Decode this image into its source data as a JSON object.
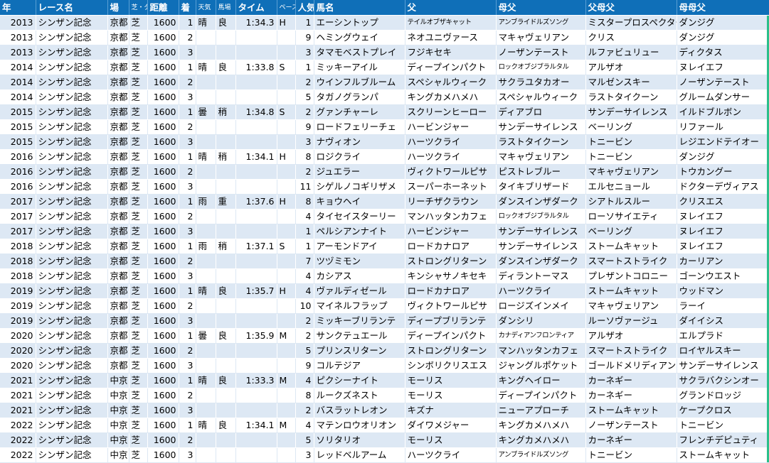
{
  "columns": [
    "年",
    "レース名",
    "場",
    "芝・ダ",
    "距離",
    "着",
    "天気",
    "馬場",
    "タイム",
    "ペース",
    "人気",
    "馬名",
    "父",
    "母父",
    "父母父",
    "母母父"
  ],
  "rows": [
    [
      "2013",
      "シンザン記念",
      "京都",
      "芝",
      "1600",
      "1",
      "晴",
      "良",
      "1:34.3",
      "H",
      "1",
      "エーシントップ",
      "テイルオブザキャット",
      "アンブライドルズソング",
      "ミスタープロスペクター",
      "ダンジグ"
    ],
    [
      "2013",
      "シンザン記念",
      "京都",
      "芝",
      "1600",
      "2",
      "",
      "",
      "",
      "",
      "9",
      "ヘミングウェイ",
      "ネオユニヴァース",
      "マキャヴェリアン",
      "クリス",
      "ダンジグ"
    ],
    [
      "2013",
      "シンザン記念",
      "京都",
      "芝",
      "1600",
      "3",
      "",
      "",
      "",
      "",
      "3",
      "タマモベストプレイ",
      "フジキセキ",
      "ノーザンテースト",
      "ルファビュリュー",
      "ディクタス"
    ],
    [
      "2014",
      "シンザン記念",
      "京都",
      "芝",
      "1600",
      "1",
      "晴",
      "良",
      "1:33.8",
      "S",
      "1",
      "ミッキーアイル",
      "ディープインパクト",
      "ロックオブジブラルタル",
      "アルザオ",
      "ヌレイエフ"
    ],
    [
      "2014",
      "シンザン記念",
      "京都",
      "芝",
      "1600",
      "2",
      "",
      "",
      "",
      "",
      "2",
      "ウインフルブルーム",
      "スペシャルウィーク",
      "サクラユタカオー",
      "マルゼンスキー",
      "ノーザンテースト"
    ],
    [
      "2014",
      "シンザン記念",
      "京都",
      "芝",
      "1600",
      "3",
      "",
      "",
      "",
      "",
      "5",
      "タガノグランパ",
      "キングカメハメハ",
      "スペシャルウィーク",
      "ラストタイクーン",
      "グルームダンサー"
    ],
    [
      "2015",
      "シンザン記念",
      "京都",
      "芝",
      "1600",
      "1",
      "曇",
      "稍",
      "1:34.8",
      "S",
      "2",
      "グァンチャーレ",
      "スクリーンヒーロー",
      "ディアブロ",
      "サンデーサイレンス",
      "イルドブルボン"
    ],
    [
      "2015",
      "シンザン記念",
      "京都",
      "芝",
      "1600",
      "2",
      "",
      "",
      "",
      "",
      "9",
      "ロードフェリーチェ",
      "ハービンジャー",
      "サンデーサイレンス",
      "ベーリング",
      "リファール"
    ],
    [
      "2015",
      "シンザン記念",
      "京都",
      "芝",
      "1600",
      "3",
      "",
      "",
      "",
      "",
      "3",
      "ナヴィオン",
      "ハーツクライ",
      "ラストタイクーン",
      "トニービン",
      "レジエンドテイオー"
    ],
    [
      "2016",
      "シンザン記念",
      "京都",
      "芝",
      "1600",
      "1",
      "晴",
      "稍",
      "1:34.1",
      "H",
      "8",
      "ロジクライ",
      "ハーツクライ",
      "マキャヴェリアン",
      "トニービン",
      "ダンジグ"
    ],
    [
      "2016",
      "シンザン記念",
      "京都",
      "芝",
      "1600",
      "2",
      "",
      "",
      "",
      "",
      "2",
      "ジュエラー",
      "ヴィクトワールピサ",
      "ピストレブルー",
      "マキャヴェリアン",
      "トウカングー"
    ],
    [
      "2016",
      "シンザン記念",
      "京都",
      "芝",
      "1600",
      "3",
      "",
      "",
      "",
      "",
      "11",
      "シゲルノコギリザメ",
      "スーパーホーネット",
      "タイキブリザード",
      "エルセニョール",
      "ドクターデヴィアス"
    ],
    [
      "2017",
      "シンザン記念",
      "京都",
      "芝",
      "1600",
      "1",
      "雨",
      "重",
      "1:37.6",
      "H",
      "8",
      "キョウヘイ",
      "リーチザクラウン",
      "ダンスインザダーク",
      "シアトルスルー",
      "クリスエス"
    ],
    [
      "2017",
      "シンザン記念",
      "京都",
      "芝",
      "1600",
      "2",
      "",
      "",
      "",
      "",
      "4",
      "タイセイスターリー",
      "マンハッタンカフェ",
      "ロックオブジブラルタル",
      "ローソサイエティ",
      "ヌレイエフ"
    ],
    [
      "2017",
      "シンザン記念",
      "京都",
      "芝",
      "1600",
      "3",
      "",
      "",
      "",
      "",
      "1",
      "ペルシアンナイト",
      "ハービンジャー",
      "サンデーサイレンス",
      "ベーリング",
      "ヌレイエフ"
    ],
    [
      "2018",
      "シンザン記念",
      "京都",
      "芝",
      "1600",
      "1",
      "雨",
      "稍",
      "1:37.1",
      "S",
      "1",
      "アーモンドアイ",
      "ロードカナロア",
      "サンデーサイレンス",
      "ストームキャット",
      "ヌレイエフ"
    ],
    [
      "2018",
      "シンザン記念",
      "京都",
      "芝",
      "1600",
      "2",
      "",
      "",
      "",
      "",
      "7",
      "ツヅミモン",
      "ストロングリターン",
      "ダンスインザダーク",
      "スマートストライク",
      "カーリアン"
    ],
    [
      "2018",
      "シンザン記念",
      "京都",
      "芝",
      "1600",
      "3",
      "",
      "",
      "",
      "",
      "4",
      "カシアス",
      "キンシャサノキセキ",
      "ディラントーマス",
      "プレザントコロニー",
      "ゴーンウエスト"
    ],
    [
      "2019",
      "シンザン記念",
      "京都",
      "芝",
      "1600",
      "1",
      "晴",
      "良",
      "1:35.7",
      "H",
      "4",
      "ヴァルディゼール",
      "ロードカナロア",
      "ハーツクライ",
      "ストームキャット",
      "ウッドマン"
    ],
    [
      "2019",
      "シンザン記念",
      "京都",
      "芝",
      "1600",
      "2",
      "",
      "",
      "",
      "",
      "10",
      "マイネルフラップ",
      "ヴィクトワールピサ",
      "ロージズインメイ",
      "マキャヴェリアン",
      "ラーイ"
    ],
    [
      "2019",
      "シンザン記念",
      "京都",
      "芝",
      "1600",
      "3",
      "",
      "",
      "",
      "",
      "2",
      "ミッキーブリランテ",
      "ディープブリランテ",
      "ダンシリ",
      "ルーソヴァージュ",
      "ダイイシス"
    ],
    [
      "2020",
      "シンザン記念",
      "京都",
      "芝",
      "1600",
      "1",
      "曇",
      "良",
      "1:35.9",
      "M",
      "2",
      "サンクテュエール",
      "ディープインパクト",
      "カナディアンフロンティア",
      "アルザオ",
      "エルプラド"
    ],
    [
      "2020",
      "シンザン記念",
      "京都",
      "芝",
      "1600",
      "2",
      "",
      "",
      "",
      "",
      "5",
      "プリンスリターン",
      "ストロングリターン",
      "マンハッタンカフェ",
      "スマートストライク",
      "ロイヤルスキー"
    ],
    [
      "2020",
      "シンザン記念",
      "京都",
      "芝",
      "1600",
      "3",
      "",
      "",
      "",
      "",
      "9",
      "コルテジア",
      "シンボリクリスエス",
      "ジャングルポケット",
      "ゴールドメリディアン",
      "サンデーサイレンス"
    ],
    [
      "2021",
      "シンザン記念",
      "中京",
      "芝",
      "1600",
      "1",
      "晴",
      "良",
      "1:33.3",
      "M",
      "4",
      "ピクシーナイト",
      "モーリス",
      "キングヘイロー",
      "カーネギー",
      "サクラバクシンオー"
    ],
    [
      "2021",
      "シンザン記念",
      "中京",
      "芝",
      "1600",
      "2",
      "",
      "",
      "",
      "",
      "8",
      "ルークズネスト",
      "モーリス",
      "ディープインパクト",
      "カーネギー",
      "グランドロッジ"
    ],
    [
      "2021",
      "シンザン記念",
      "中京",
      "芝",
      "1600",
      "3",
      "",
      "",
      "",
      "",
      "2",
      "バスラットレオン",
      "キズナ",
      "ニューアプローチ",
      "ストームキャット",
      "ケープクロス"
    ],
    [
      "2022",
      "シンザン記念",
      "中京",
      "芝",
      "1600",
      "1",
      "晴",
      "良",
      "1:34.1",
      "M",
      "4",
      "マテンロウオリオン",
      "ダイワメジャー",
      "キングカメハメハ",
      "ノーザンテースト",
      "トニービン"
    ],
    [
      "2022",
      "シンザン記念",
      "中京",
      "芝",
      "1600",
      "2",
      "",
      "",
      "",
      "",
      "5",
      "ソリタリオ",
      "モーリス",
      "キングカメハメハ",
      "カーネギー",
      "フレンチデピュティ"
    ],
    [
      "2022",
      "シンザン記念",
      "中京",
      "芝",
      "1600",
      "3",
      "",
      "",
      "",
      "",
      "3",
      "レッドベルアーム",
      "ハーツクライ",
      "アンブライドルズソング",
      "トニービン",
      "ストームキャット"
    ]
  ],
  "colors": {
    "header": "#0f6fb8",
    "band": "#dde8f4",
    "edge_accent": "#2bbf8a"
  }
}
